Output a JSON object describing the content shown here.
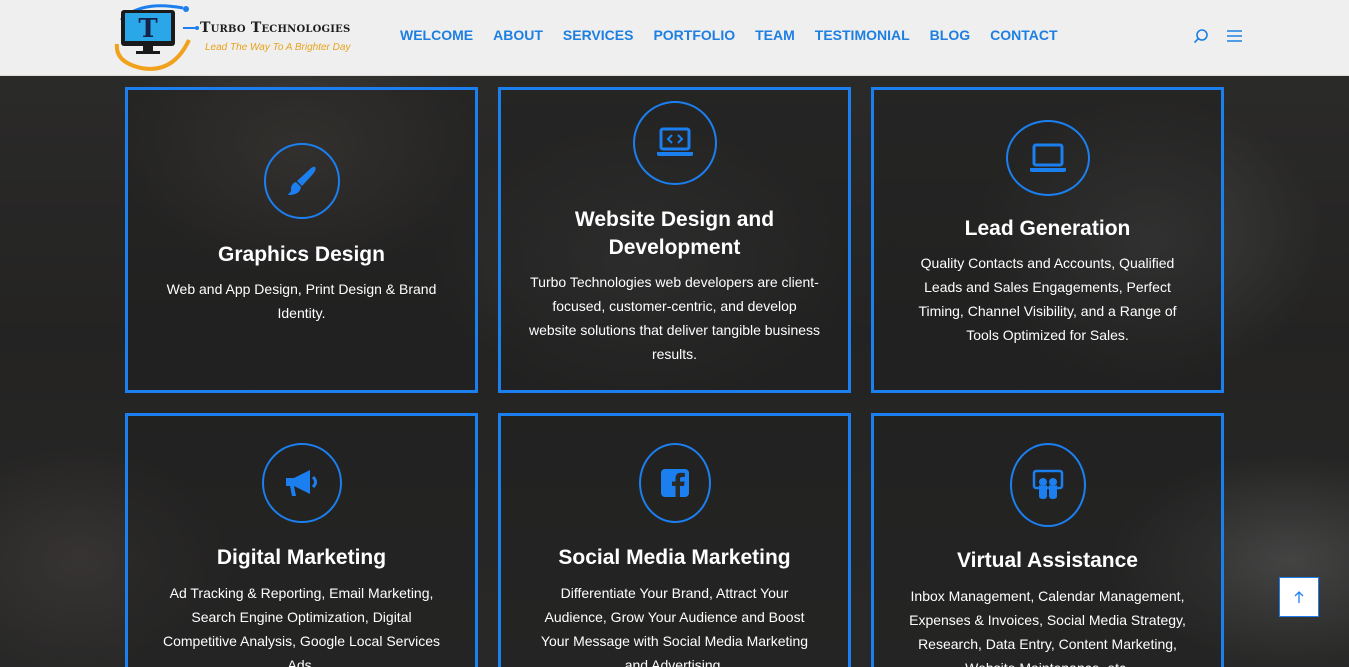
{
  "header": {
    "logo": {
      "letter": "T",
      "title": "Turbo Technologies",
      "tagline": "Lead The Way To A Brighter Day"
    },
    "nav": [
      "WELCOME",
      "ABOUT",
      "SERVICES",
      "PORTFOLIO",
      "TEAM",
      "TESTIMONIAL",
      "BLOG",
      "CONTACT"
    ],
    "icons": [
      "search-icon",
      "menu-icon"
    ]
  },
  "colors": {
    "accent": "#1b7ff0",
    "nav": "#1e7fe3",
    "header_bg": "#efefef",
    "tagline": "#e7a31a"
  },
  "services": [
    {
      "icon": "paintbrush-icon",
      "title": "Graphics Design",
      "text": "Web and App Design, Print Design & Brand Identity."
    },
    {
      "icon": "code-laptop-icon",
      "title": "Website Design and Development",
      "text": "Turbo Technologies web developers are client-focused, customer-centric, and develop website solutions that deliver tangible business results."
    },
    {
      "icon": "laptop-icon",
      "title": "Lead Generation",
      "text": "Quality Contacts and Accounts, Qualified Leads and Sales Engagements, Perfect Timing, Channel Visibility, and a Range of Tools Optimized for Sales."
    },
    {
      "icon": "megaphone-icon",
      "title": "Digital Marketing",
      "text": "Ad Tracking & Reporting, Email Marketing, Search Engine Optimization, Digital Competitive Analysis, Google Local Services Ads."
    },
    {
      "icon": "facebook-icon",
      "title": "Social Media Marketing",
      "text": "Differentiate Your Brand, Attract Your Audience, Grow Your Audience and Boost Your Message with Social Media Marketing and Advertising."
    },
    {
      "icon": "slideshare-icon",
      "title": "Virtual Assistance",
      "text": "Inbox Management, Calendar Management, Expenses & Invoices, Social Media Strategy, Research, Data Entry, Content Marketing, Website Maintenance, etc."
    }
  ],
  "back_to_top": {
    "icon": "arrow-up-icon"
  }
}
